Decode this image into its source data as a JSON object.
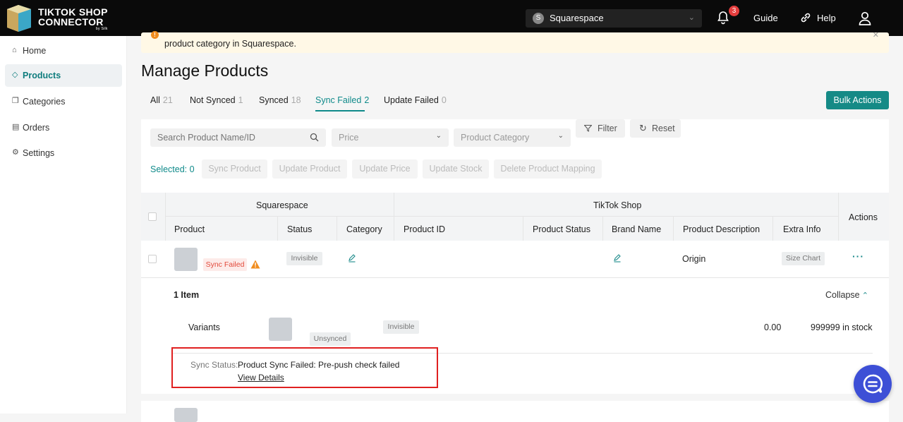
{
  "header": {
    "logo_line1": "TIKTOK SHOP",
    "logo_line2": "CONNECTOR",
    "logo_small": "by Silk",
    "store_initial": "S",
    "store_name": "Squarespace",
    "notifications": "3",
    "guide": "Guide",
    "help": "Help"
  },
  "sidebar": {
    "items": [
      {
        "label": "Home",
        "icon": "home-icon"
      },
      {
        "label": "Products",
        "icon": "tag-icon"
      },
      {
        "label": "Categories",
        "icon": "categories-icon"
      },
      {
        "label": "Orders",
        "icon": "orders-icon"
      },
      {
        "label": "Settings",
        "icon": "gear-icon"
      }
    ]
  },
  "alert": {
    "text": "product category in Squarespace."
  },
  "page_title": "Manage Products",
  "tabs": [
    {
      "label": "All",
      "count": "21"
    },
    {
      "label": "Not Synced",
      "count": "1"
    },
    {
      "label": "Synced",
      "count": "18"
    },
    {
      "label": "Sync Failed",
      "count": "2"
    },
    {
      "label": "Update Failed",
      "count": "0"
    }
  ],
  "bulk_actions": "Bulk Actions",
  "filters": {
    "search_placeholder": "Search Product Name/ID",
    "price": "Price",
    "category": "Product Category",
    "filter": "Filter",
    "reset": "Reset"
  },
  "actions": {
    "selected": "Selected: 0",
    "sync_product": "Sync Product",
    "update_product": "Update Product",
    "update_price": "Update Price",
    "update_stock": "Update Stock",
    "delete_mapping": "Delete Product Mapping"
  },
  "table": {
    "group_squarespace": "Squarespace",
    "group_tiktok": "TikTok Shop",
    "col_product": "Product",
    "col_status": "Status",
    "col_category": "Category",
    "col_product_id": "Product ID",
    "col_product_status": "Product Status",
    "col_brand_name": "Brand Name",
    "col_product_description": "Product Description",
    "col_extra_info": "Extra Info",
    "col_actions": "Actions",
    "row": {
      "sync_failed": "Sync Failed",
      "status": "Invisible",
      "description": "Origin",
      "extra_info": "Size Chart",
      "more": "···"
    },
    "items_label": "1 Item",
    "collapse": "Collapse",
    "variant": {
      "label": "Variants",
      "sync": "Unsynced",
      "status": "Invisible",
      "price": "0.00",
      "stock": "999999 in stock"
    },
    "sync_status_label": "Sync Status:",
    "sync_status_value": "Product Sync Failed: Pre-push check failed",
    "view_details": "View Details"
  },
  "colors": {
    "accent": "#158a86",
    "alert_bg": "#fff8e6",
    "error": "#e02020"
  }
}
